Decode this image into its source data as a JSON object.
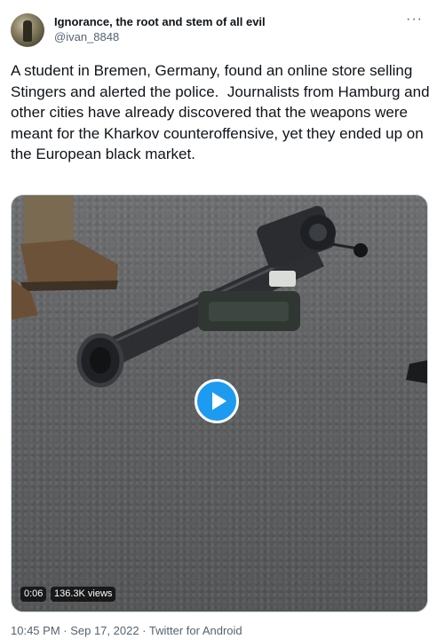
{
  "author": {
    "display_name": "Ignorance, the root and stem of all evil",
    "handle": "@ivan_8848",
    "avatar_icon": "profile-photo"
  },
  "more_menu": {
    "label": "···",
    "icon": "more-horizontal-icon"
  },
  "tweet": {
    "text": "A student in Bremen, Germany, found an online store selling Stingers and alerted the police.  Journalists from Hamburg and other cities have already discovered that the weapons were meant for the Kharkov counteroffensive, yet they ended up on the European black market."
  },
  "video": {
    "duration": "0:06",
    "views": "136.3K views",
    "play_icon": "play-icon",
    "accent_color": "#1d9bf0"
  },
  "meta": {
    "timestamp": "10:45 PM · Sep 17, 2022 · Twitter for Android"
  },
  "colors": {
    "text": "#0f1419",
    "secondary": "#536471",
    "border": "#cfd9de"
  }
}
